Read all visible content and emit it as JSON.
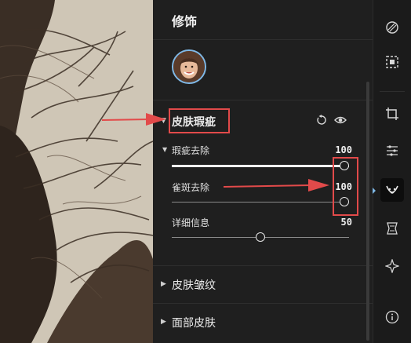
{
  "panel": {
    "title": "修饰",
    "sections": [
      {
        "label": "皮肤瑕疵",
        "expanded": true,
        "subsections": [
          {
            "label": "瑕疵去除",
            "sliders": [
              {
                "label": "瑕疵去除",
                "value": "100",
                "level": 1.0
              },
              {
                "label": "雀斑去除",
                "value": "100",
                "level": 1.0
              }
            ]
          }
        ],
        "extra_sliders": [
          {
            "label": "详细信息",
            "value": "50",
            "level": 0.5
          }
        ]
      },
      {
        "label": "皮肤皱纹",
        "expanded": false
      },
      {
        "label": "面部皮肤",
        "expanded": false
      }
    ]
  },
  "icons": {
    "reset": "reset-icon",
    "visibility": "eye-icon",
    "toolbar": [
      "mask-icon",
      "selection-icon",
      "crop-icon",
      "adjust-icon",
      "retouch-icon",
      "liquify-icon",
      "ai-spark-icon",
      "info-icon"
    ]
  },
  "colors": {
    "accent_red": "#e24a4a",
    "panel_bg": "#1f1f1f",
    "toolbar_active": "#0d0d0d",
    "avatar_ring": "#7fb8e6"
  }
}
